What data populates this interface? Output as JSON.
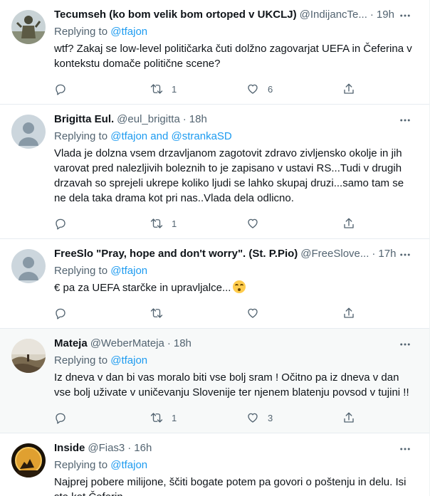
{
  "tweets": [
    {
      "name": "Tecumseh (ko bom velik bom ortoped v UKCLJ)",
      "handle": "@IndijancTe...",
      "dot": "·",
      "time": "19h",
      "replying_prefix": "Replying to ",
      "mentions": "@tfajon",
      "text": "wtf? Zakaj se low-level političarka čuti dolžno zagovarjat UEFA in Čeferina v kontekstu domače politične scene?",
      "retweets": "1",
      "likes": "6",
      "avatar": "statue"
    },
    {
      "name": "Brigitta Eul.",
      "handle": "@eul_brigitta",
      "dot": "·",
      "time": "18h",
      "replying_prefix": "Replying to ",
      "mentions": "@tfajon and @strankaSD",
      "text": "Vlada je dolzna vsem drzavljanom zagotovit zdravo zivljensko okolje in jih varovat pred nalezljivih boleznih to je zapisano v ustavi RS...Tudi v drugih drzavah so sprejeli ukrepe koliko ljudi se lahko skupaj druzi...samo tam se ne dela taka drama kot pri nas..Vlada dela odlicno.",
      "retweets": "1",
      "likes": "",
      "avatar": "default"
    },
    {
      "name": "FreeSlo \"Pray, hope and don't worry\". (St. P.Pio)",
      "handle": "@FreeSlove...",
      "dot": "·",
      "time": "17h",
      "replying_prefix": "Replying to ",
      "mentions": "@tfajon",
      "text": "€ pa za UEFA starčke in upravljalce...",
      "retweets": "",
      "likes": "",
      "avatar": "default"
    },
    {
      "name": "Mateja",
      "handle": "@WeberMateja",
      "dot": "·",
      "time": "18h",
      "replying_prefix": "Replying to ",
      "mentions": "@tfajon",
      "text": "Iz dneva v dan bi vas moralo biti vse bolj sram ! Očitno pa iz dneva v dan vse bolj  uživate v uničevanju Slovenije ter njenem blatenju povsod v tujini !!",
      "retweets": "1",
      "likes": "3",
      "avatar": "landscape"
    },
    {
      "name": "Inside",
      "handle": "@Fias3",
      "dot": "·",
      "time": "16h",
      "replying_prefix": "Replying to ",
      "mentions": "@tfajon",
      "text": "Najprej pobere milijone, ščiti bogate potem pa govori o poštenju in delu. Isi ste kot Čeferin.",
      "retweets": "",
      "likes": "",
      "avatar": "moon"
    }
  ],
  "colors": {
    "accent": "#1d9bf0",
    "muted": "#536471",
    "text": "#0f1419",
    "highlight_bg": "#f7f9f9"
  },
  "icons": [
    "more-icon",
    "reply-icon",
    "retweet-icon",
    "like-icon",
    "share-icon",
    "emoji-upside-down-face"
  ]
}
